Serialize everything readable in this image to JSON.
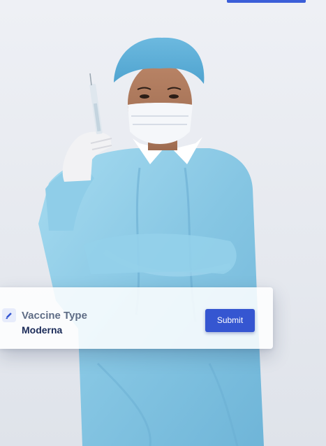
{
  "card": {
    "field_icon": "pencil-icon",
    "field_label": "Vaccine Type",
    "field_value": "Moderna",
    "submit_label": "Submit"
  },
  "colors": {
    "accent": "#3556d1",
    "label": "#5e6c85",
    "value": "#1b2b58",
    "gown": "#8ccbe6",
    "background": "#e9ecf2"
  }
}
